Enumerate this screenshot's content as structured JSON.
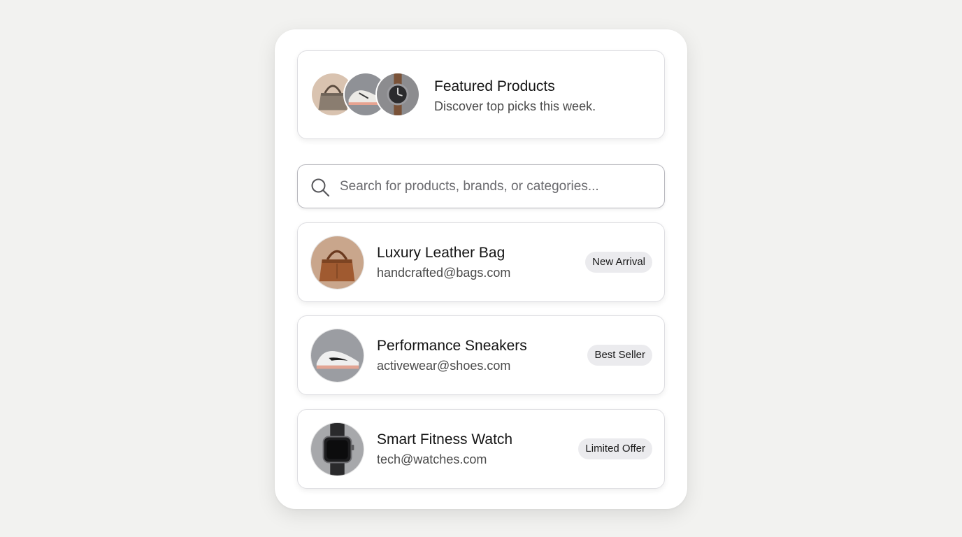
{
  "featured": {
    "title": "Featured Products",
    "subtitle": "Discover top picks this week.",
    "avatars": [
      "handbag-image",
      "sneaker-image",
      "watch-image"
    ]
  },
  "search": {
    "placeholder": "Search for products, brands, or categories...",
    "icon": "search-icon"
  },
  "products": [
    {
      "name": "Luxury Leather Bag",
      "email": "handcrafted@bags.com",
      "badge": "New Arrival",
      "image": "leather-bag-image"
    },
    {
      "name": "Performance Sneakers",
      "email": "activewear@shoes.com",
      "badge": "Best Seller",
      "image": "sneakers-image"
    },
    {
      "name": "Smart Fitness Watch",
      "email": "tech@watches.com",
      "badge": "Limited Offer",
      "image": "smart-watch-image"
    }
  ],
  "colors": {
    "background": "#f2f2f0",
    "panel": "#ffffff",
    "badge": "#ebebee",
    "border": "#dedee2"
  }
}
